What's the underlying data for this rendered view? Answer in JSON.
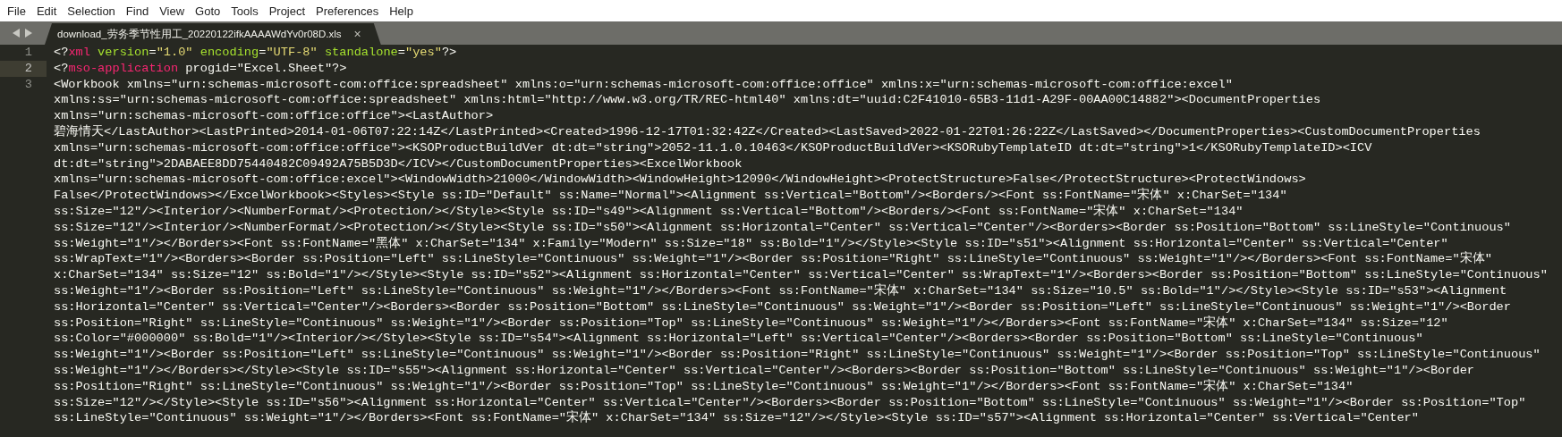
{
  "menu": [
    "File",
    "Edit",
    "Selection",
    "Find",
    "View",
    "Goto",
    "Tools",
    "Project",
    "Preferences",
    "Help"
  ],
  "tab": {
    "title": "download_劳务季节性用工_20220122ifkAAAAWdYv0r08D.xls",
    "close": "×"
  },
  "editor": {
    "lines": [
      {
        "number": "1",
        "current": false,
        "rows": [
          {
            "tokens": [
              {
                "kind": "punct",
                "text": "<?"
              },
              {
                "kind": "tag",
                "text": "xml"
              },
              {
                "kind": "attr",
                "text": " version"
              },
              {
                "kind": "punct",
                "text": "="
              },
              {
                "kind": "string",
                "text": "\"1.0\""
              },
              {
                "kind": "attr",
                "text": " encoding"
              },
              {
                "kind": "punct",
                "text": "="
              },
              {
                "kind": "string",
                "text": "\"UTF-8\""
              },
              {
                "kind": "attr",
                "text": " standalone"
              },
              {
                "kind": "punct",
                "text": "="
              },
              {
                "kind": "string",
                "text": "\"yes\""
              },
              {
                "kind": "punct",
                "text": "?>"
              }
            ]
          }
        ]
      },
      {
        "number": "2",
        "current": true,
        "rows": [
          {
            "tokens": [
              {
                "kind": "punct",
                "text": "<?"
              },
              {
                "kind": "tag",
                "text": "mso-application"
              },
              {
                "kind": "punct",
                "text": " progid=\"Excel.Sheet\"?>"
              }
            ]
          }
        ]
      },
      {
        "number": "3",
        "current": false,
        "rows": [
          {
            "text": "<Workbook xmlns=\"urn:schemas-microsoft-com:office:spreadsheet\" xmlns:o=\"urn:schemas-microsoft-com:office:office\" xmlns:x=\"urn:schemas-microsoft-com:office:excel\""
          },
          {
            "text": "xmlns:ss=\"urn:schemas-microsoft-com:office:spreadsheet\" xmlns:html=\"http://www.w3.org/TR/REC-html40\" xmlns:dt=\"uuid:C2F41010-65B3-11d1-A29F-00AA00C14882\"><DocumentProperties"
          },
          {
            "text": "xmlns=\"urn:schemas-microsoft-com:office:office\"><LastAuthor>"
          },
          {
            "text": "碧海情天</LastAuthor><LastPrinted>2014-01-06T07:22:14Z</LastPrinted><Created>1996-12-17T01:32:42Z</Created><LastSaved>2022-01-22T01:26:22Z</LastSaved></DocumentProperties><CustomDocumentProperties"
          },
          {
            "text": "xmlns=\"urn:schemas-microsoft-com:office:office\"><KSOProductBuildVer dt:dt=\"string\">2052-11.1.0.10463</KSOProductBuildVer><KSORubyTemplateID dt:dt=\"string\">1</KSORubyTemplateID><ICV"
          },
          {
            "text": "dt:dt=\"string\">2DABAEE8DD75440482C09492A75B5D3D</ICV></CustomDocumentProperties><ExcelWorkbook"
          },
          {
            "text": "xmlns=\"urn:schemas-microsoft-com:office:excel\"><WindowWidth>21000</WindowWidth><WindowHeight>12090</WindowHeight><ProtectStructure>False</ProtectStructure><ProtectWindows>"
          },
          {
            "text": "False</ProtectWindows></ExcelWorkbook><Styles><Style ss:ID=\"Default\" ss:Name=\"Normal\"><Alignment ss:Vertical=\"Bottom\"/><Borders/><Font ss:FontName=\"宋体\" x:CharSet=\"134\""
          },
          {
            "text": "ss:Size=\"12\"/><Interior/><NumberFormat/><Protection/></Style><Style ss:ID=\"s49\"><Alignment ss:Vertical=\"Bottom\"/><Borders/><Font ss:FontName=\"宋体\" x:CharSet=\"134\""
          },
          {
            "text": "ss:Size=\"12\"/><Interior/><NumberFormat/><Protection/></Style><Style ss:ID=\"s50\"><Alignment ss:Horizontal=\"Center\" ss:Vertical=\"Center\"/><Borders><Border ss:Position=\"Bottom\" ss:LineStyle=\"Continuous\""
          },
          {
            "text": "ss:Weight=\"1\"/></Borders><Font ss:FontName=\"黑体\" x:CharSet=\"134\" x:Family=\"Modern\" ss:Size=\"18\" ss:Bold=\"1\"/></Style><Style ss:ID=\"s51\"><Alignment ss:Horizontal=\"Center\" ss:Vertical=\"Center\""
          },
          {
            "text": "ss:WrapText=\"1\"/><Borders><Border ss:Position=\"Left\" ss:LineStyle=\"Continuous\" ss:Weight=\"1\"/><Border ss:Position=\"Right\" ss:LineStyle=\"Continuous\" ss:Weight=\"1\"/></Borders><Font ss:FontName=\"宋体\""
          },
          {
            "text": "x:CharSet=\"134\" ss:Size=\"12\" ss:Bold=\"1\"/></Style><Style ss:ID=\"s52\"><Alignment ss:Horizontal=\"Center\" ss:Vertical=\"Center\" ss:WrapText=\"1\"/><Borders><Border ss:Position=\"Bottom\" ss:LineStyle=\"Continuous\""
          },
          {
            "text": "ss:Weight=\"1\"/><Border ss:Position=\"Left\" ss:LineStyle=\"Continuous\" ss:Weight=\"1\"/></Borders><Font ss:FontName=\"宋体\" x:CharSet=\"134\" ss:Size=\"10.5\" ss:Bold=\"1\"/></Style><Style ss:ID=\"s53\"><Alignment"
          },
          {
            "text": "ss:Horizontal=\"Center\" ss:Vertical=\"Center\"/><Borders><Border ss:Position=\"Bottom\" ss:LineStyle=\"Continuous\" ss:Weight=\"1\"/><Border ss:Position=\"Left\" ss:LineStyle=\"Continuous\" ss:Weight=\"1\"/><Border"
          },
          {
            "text": "ss:Position=\"Right\" ss:LineStyle=\"Continuous\" ss:Weight=\"1\"/><Border ss:Position=\"Top\" ss:LineStyle=\"Continuous\" ss:Weight=\"1\"/></Borders><Font ss:FontName=\"宋体\" x:CharSet=\"134\" ss:Size=\"12\""
          },
          {
            "text": "ss:Color=\"#000000\" ss:Bold=\"1\"/><Interior/></Style><Style ss:ID=\"s54\"><Alignment ss:Horizontal=\"Left\" ss:Vertical=\"Center\"/><Borders><Border ss:Position=\"Bottom\" ss:LineStyle=\"Continuous\""
          },
          {
            "text": "ss:Weight=\"1\"/><Border ss:Position=\"Left\" ss:LineStyle=\"Continuous\" ss:Weight=\"1\"/><Border ss:Position=\"Right\" ss:LineStyle=\"Continuous\" ss:Weight=\"1\"/><Border ss:Position=\"Top\" ss:LineStyle=\"Continuous\""
          },
          {
            "text": "ss:Weight=\"1\"/></Borders></Style><Style ss:ID=\"s55\"><Alignment ss:Horizontal=\"Center\" ss:Vertical=\"Center\"/><Borders><Border ss:Position=\"Bottom\" ss:LineStyle=\"Continuous\" ss:Weight=\"1\"/><Border"
          },
          {
            "text": "ss:Position=\"Right\" ss:LineStyle=\"Continuous\" ss:Weight=\"1\"/><Border ss:Position=\"Top\" ss:LineStyle=\"Continuous\" ss:Weight=\"1\"/></Borders><Font ss:FontName=\"宋体\" x:CharSet=\"134\""
          },
          {
            "text": "ss:Size=\"12\"/></Style><Style ss:ID=\"s56\"><Alignment ss:Horizontal=\"Center\" ss:Vertical=\"Center\"/><Borders><Border ss:Position=\"Bottom\" ss:LineStyle=\"Continuous\" ss:Weight=\"1\"/><Border ss:Position=\"Top\""
          },
          {
            "text": "ss:LineStyle=\"Continuous\" ss:Weight=\"1\"/></Borders><Font ss:FontName=\"宋体\" x:CharSet=\"134\" ss:Size=\"12\"/></Style><Style ss:ID=\"s57\"><Alignment ss:Horizontal=\"Center\" ss:Vertical=\"Center\""
          }
        ]
      }
    ]
  }
}
